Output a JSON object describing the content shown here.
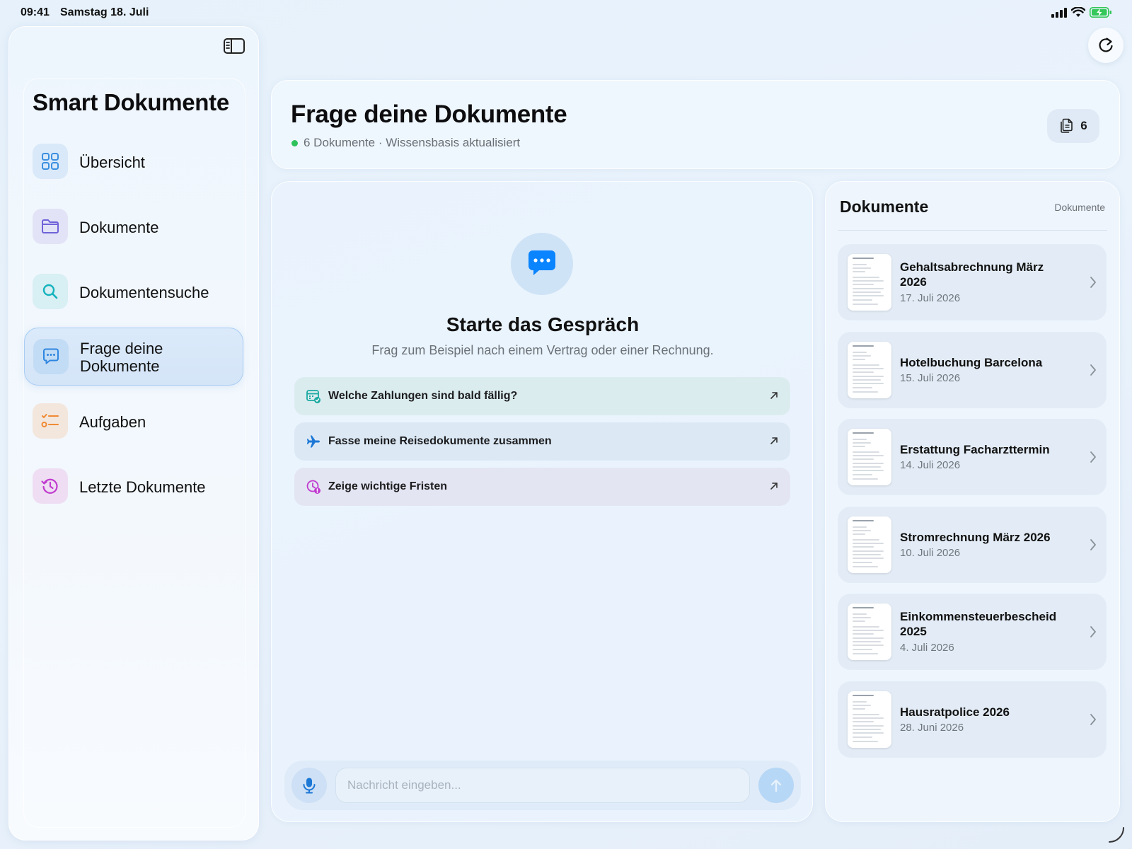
{
  "status_bar": {
    "time": "09:41",
    "date": "Samstag 18. Juli"
  },
  "sidebar": {
    "title": "Smart Dokumente",
    "items": [
      {
        "label": "Übersicht",
        "icon": "grid-icon",
        "color": "#3b8fe0"
      },
      {
        "label": "Dokumente",
        "icon": "folder-icon",
        "color": "#6f63d9"
      },
      {
        "label": "Dokumentensuche",
        "icon": "search-icon",
        "color": "#14b3bd"
      },
      {
        "label": "Frage deine Dokumente",
        "icon": "chat-icon",
        "color": "#2f86e0",
        "active": true
      },
      {
        "label": "Aufgaben",
        "icon": "checklist-icon",
        "color": "#f08a33"
      },
      {
        "label": "Letzte Dokumente",
        "icon": "history-icon",
        "color": "#c03ccf"
      }
    ]
  },
  "header": {
    "title": "Frage deine Dokumente",
    "subtitle": "6 Dokumente · Wissensbasis aktualisiert",
    "doc_count": "6"
  },
  "chat": {
    "heading": "Starte das Gespräch",
    "hint": "Frag zum Beispiel nach einem Vertrag oder einer Rechnung.",
    "suggestions": [
      {
        "label": "Welche Zahlungen sind bald fällig?",
        "icon": "calendar-check-icon",
        "bg": "#dbecef"
      },
      {
        "label": "Fasse meine Reisedokumente zusammen",
        "icon": "airplane-icon",
        "bg": "#dce9f5"
      },
      {
        "label": "Zeige wichtige Fristen",
        "icon": "clock-alert-icon",
        "bg": "#e4e5f3"
      }
    ],
    "input_placeholder": "Nachricht eingeben..."
  },
  "documents": {
    "title": "Dokumente",
    "link_label": "Dokumente",
    "items": [
      {
        "name": "Gehaltsabrechnung März 2026",
        "date": "17. Juli 2026"
      },
      {
        "name": "Hotelbuchung Barcelona",
        "date": "15. Juli 2026"
      },
      {
        "name": "Erstattung Facharzttermin",
        "date": "14. Juli 2026"
      },
      {
        "name": "Stromrechnung März 2026",
        "date": "10. Juli 2026"
      },
      {
        "name": "Einkommensteuerbescheid 2025",
        "date": "4. Juli 2026"
      },
      {
        "name": "Hausratpolice 2026",
        "date": "28. Juni 2026"
      }
    ]
  },
  "colors": {
    "accent": "#0a84ff",
    "status_green": "#2fc25b"
  }
}
